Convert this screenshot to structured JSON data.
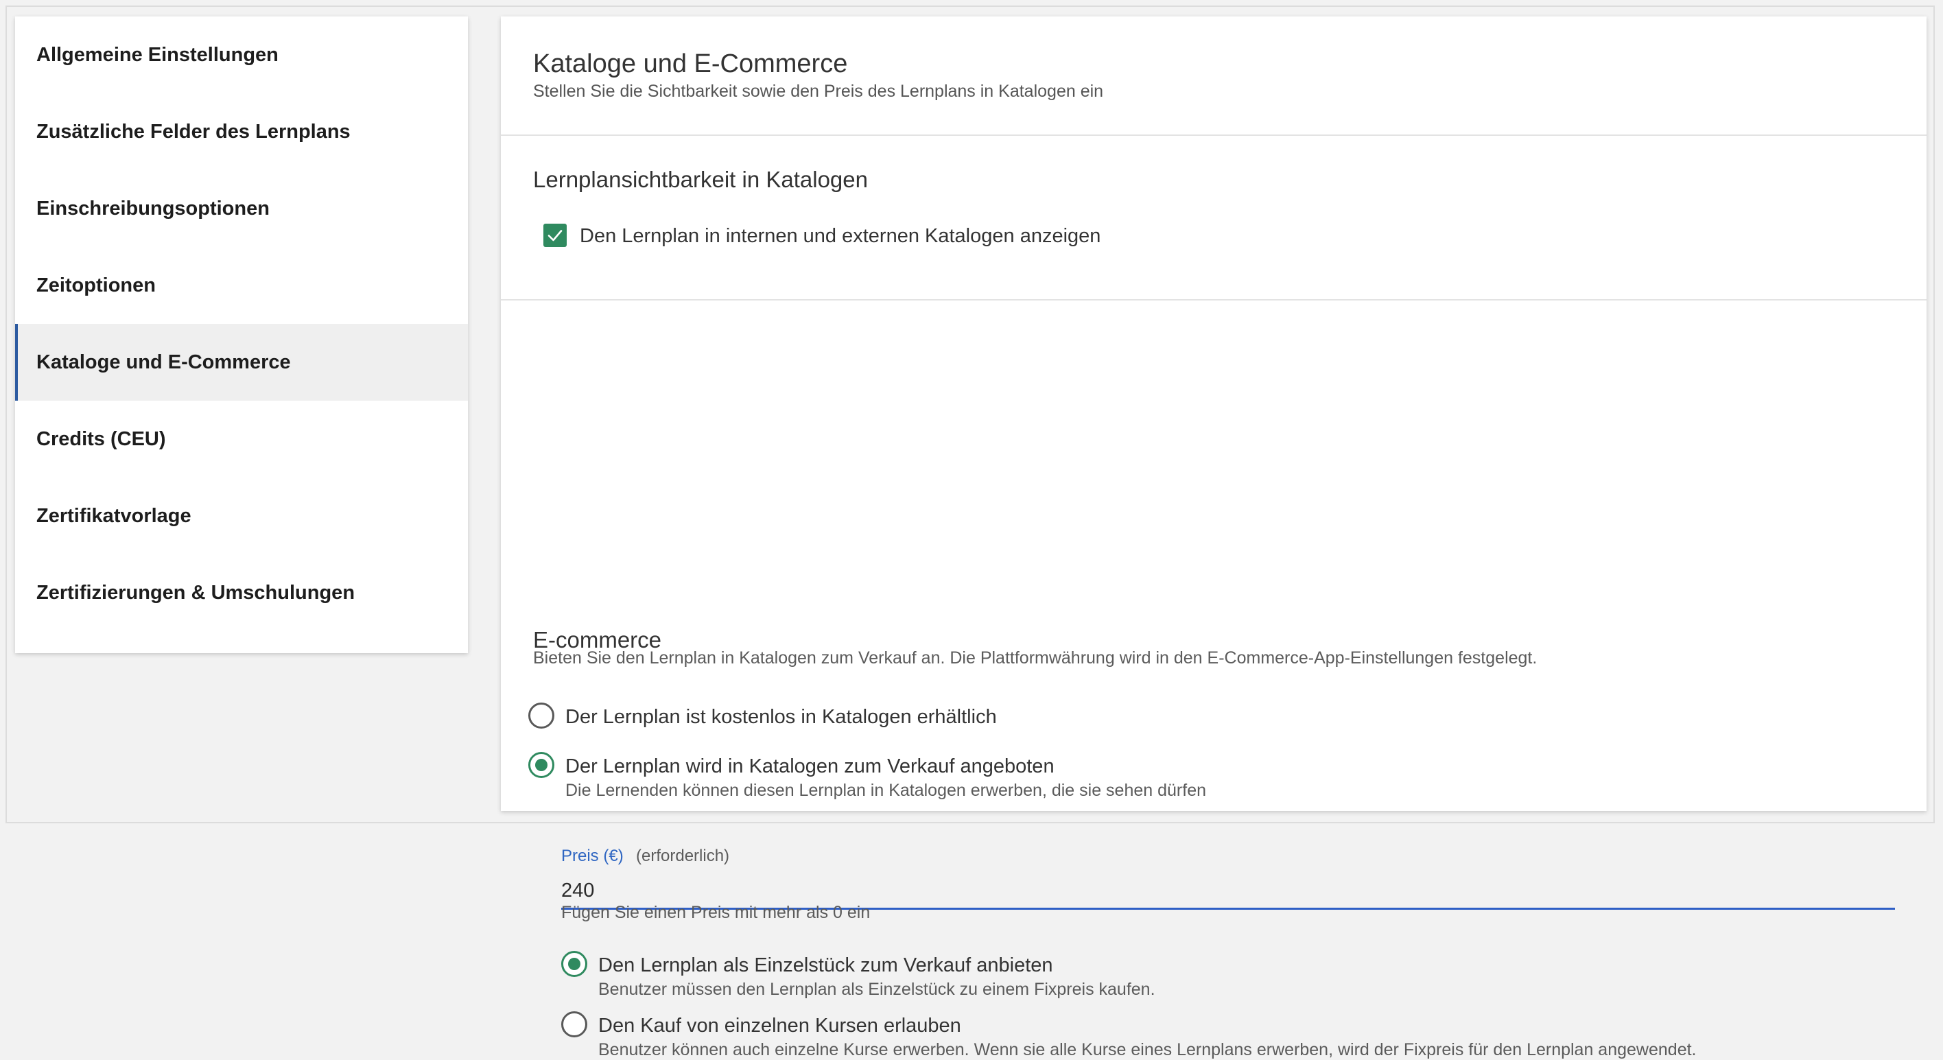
{
  "sidebar": {
    "items": [
      {
        "label": "Allgemeine Einstellungen"
      },
      {
        "label": "Zusätzliche Felder des Lernplans"
      },
      {
        "label": "Einschreibungsoptionen"
      },
      {
        "label": "Zeitoptionen"
      },
      {
        "label": "Kataloge und E-Commerce"
      },
      {
        "label": "Credits (CEU)"
      },
      {
        "label": "Zertifikatvorlage"
      },
      {
        "label": "Zertifizierungen & Umschulungen"
      }
    ],
    "active_index": 4
  },
  "main": {
    "title": "Kataloge und E-Commerce",
    "subtitle": "Stellen Sie die Sichtbarkeit sowie den Preis des Lernplans in Katalogen ein",
    "visibility": {
      "heading": "Lernplansichtbarkeit in Katalogen",
      "checkbox_label": "Den Lernplan in internen und externen Katalogen anzeigen",
      "checked": true
    },
    "ecommerce": {
      "heading": "E-commerce",
      "description": "Bieten Sie den Lernplan in Katalogen zum Verkauf an. Die Plattformwährung wird in den E-Commerce-App-Einstellungen festgelegt.",
      "option_free": {
        "label": "Der Lernplan ist kostenlos in Katalogen erhältlich",
        "checked": false
      },
      "option_sale": {
        "label": "Der Lernplan wird in Katalogen zum Verkauf angeboten",
        "help": "Die Lernenden können diesen Lernplan in Katalogen erwerben, die sie sehen dürfen",
        "checked": true
      },
      "price": {
        "label": "Preis (€)",
        "required": "(erforderlich)",
        "value": "240",
        "hint": "Fügen Sie einen Preis mit mehr als 0 ein"
      },
      "option_single": {
        "label": "Den Lernplan als Einzelstück zum Verkauf anbieten",
        "help": "Benutzer müssen den Lernplan als Einzelstück zu einem Fixpreis kaufen.",
        "checked": true
      },
      "option_courses": {
        "label": "Den Kauf von einzelnen Kursen erlauben",
        "help": "Benutzer können auch einzelne Kurse erwerben. Wenn sie alle Kurse eines Lernplans erwerben, wird der Fixpreis für den Lernplan angewendet.",
        "checked": false
      }
    }
  }
}
